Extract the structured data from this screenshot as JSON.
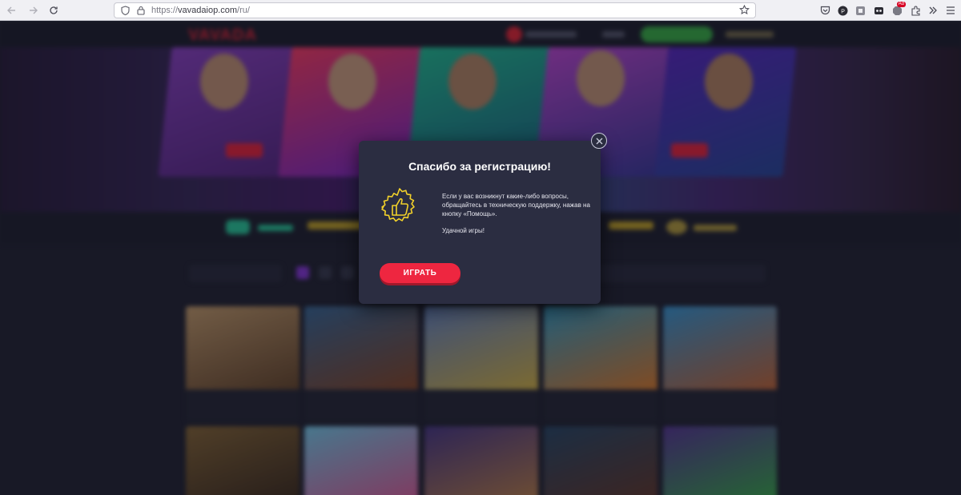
{
  "browser": {
    "url_prefix": "https://",
    "url_host": "vavadaiop.com",
    "url_path": "/ru/",
    "extension_badge": "Ad"
  },
  "site": {
    "logo": "VAVADA"
  },
  "modal": {
    "title": "Спасибо за регистрацию!",
    "message": "Если у вас возникнут какие-либо вопросы, обращайтесь в техническую поддержку, нажав на кнопку «Помощь».",
    "wish": "Удачной игры!",
    "play_button": "ИГРАТЬ",
    "accent_color": "#ee2640",
    "badge_color": "#f2d12a"
  }
}
